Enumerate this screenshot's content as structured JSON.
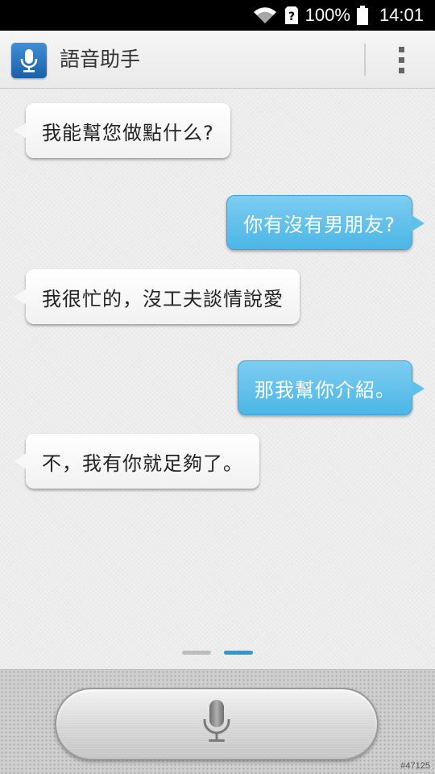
{
  "status_bar": {
    "battery": "100%",
    "time": "14:01",
    "icons": [
      "wifi-icon",
      "sim-unknown-icon",
      "battery-full-icon"
    ]
  },
  "app_bar": {
    "title": "語音助手",
    "app_icon": "microphone-icon",
    "menu_icon": "overflow-menu-icon"
  },
  "conversation": [
    {
      "side": "assistant",
      "text": "我能幫您做點什么?"
    },
    {
      "side": "user",
      "text": "你有沒有男朋友?"
    },
    {
      "side": "assistant",
      "text": "我很忙的，沒工夫談情說愛"
    },
    {
      "side": "user",
      "text": "那我幫你介紹。"
    },
    {
      "side": "assistant",
      "text": "不，我有你就足夠了。"
    }
  ],
  "page_indicator": {
    "count": 2,
    "active": 2
  },
  "bottom": {
    "mic_button_icon": "microphone-icon"
  },
  "watermark": "#47125",
  "colors": {
    "accent": "#4cb6e6",
    "active_dot": "#2b9bd0",
    "inactive_dot": "#bdbdbd"
  }
}
